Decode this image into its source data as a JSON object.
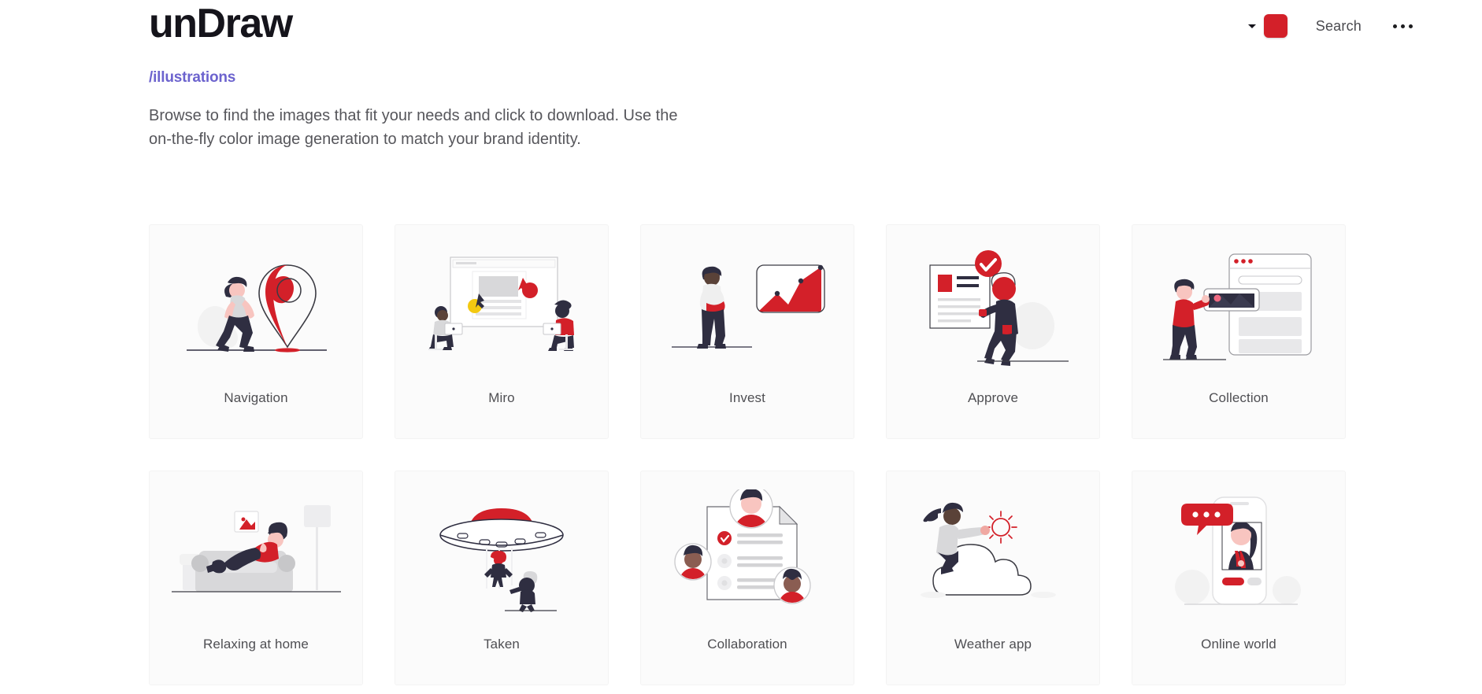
{
  "header": {
    "logo": "unDraw",
    "chevron_icon": "chevron-down-icon",
    "color_swatch_hex": "#d32029",
    "search_label": "Search",
    "more_icon": "three-dots-icon"
  },
  "intro": {
    "breadcrumb": "/illustrations",
    "description": "Browse to find the images that fit your needs and click to download. Use the on-the-fly color image generation to match your brand identity."
  },
  "theme": {
    "accent": "#d32029",
    "link": "#6c63ce",
    "dark": "#2f2e41",
    "card_bg": "#fbfbfb",
    "page_bg": "#ffffff"
  },
  "grid": {
    "cards": [
      {
        "label": "Navigation",
        "art": "navigation-illustration"
      },
      {
        "label": "Miro",
        "art": "miro-illustration"
      },
      {
        "label": "Invest",
        "art": "invest-illustration"
      },
      {
        "label": "Approve",
        "art": "approve-illustration"
      },
      {
        "label": "Collection",
        "art": "collection-illustration"
      },
      {
        "label": "Relaxing at home",
        "art": "relaxing-at-home-illustration"
      },
      {
        "label": "Taken",
        "art": "taken-illustration"
      },
      {
        "label": "Collaboration",
        "art": "collaboration-illustration"
      },
      {
        "label": "Weather app",
        "art": "weather-app-illustration"
      },
      {
        "label": "Online world",
        "art": "online-world-illustration"
      }
    ]
  }
}
